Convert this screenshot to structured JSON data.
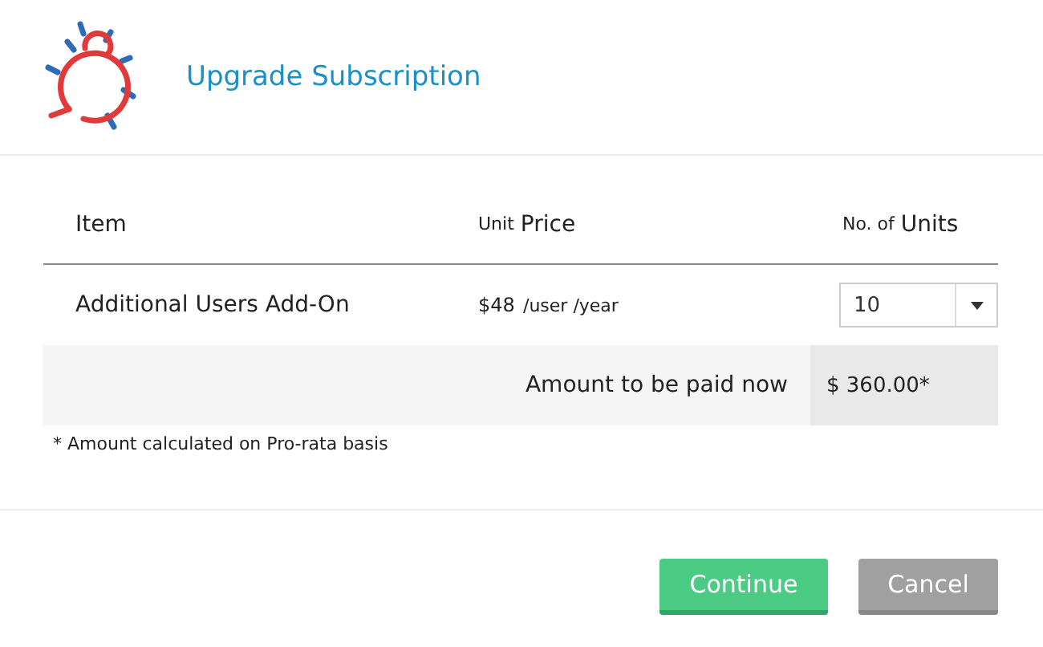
{
  "dialog": {
    "title": "Upgrade Subscription"
  },
  "table": {
    "columns": [
      {
        "label": "Item"
      },
      {
        "prefix": "Unit",
        "label": "Price"
      },
      {
        "prefix": "No. of",
        "label": "Units"
      }
    ],
    "rows": [
      {
        "item": "Additional Users Add-On",
        "price": "$48",
        "price_unit": "/user /year",
        "units": "10"
      }
    ],
    "total": {
      "label": "Amount to be paid now",
      "amount": "$ 360.00*"
    }
  },
  "footnote": "* Amount calculated on Pro-rata basis",
  "buttons": [
    {
      "kind": "primary",
      "label": "Continue"
    },
    {
      "kind": "secondary",
      "label": "Cancel"
    }
  ]
}
